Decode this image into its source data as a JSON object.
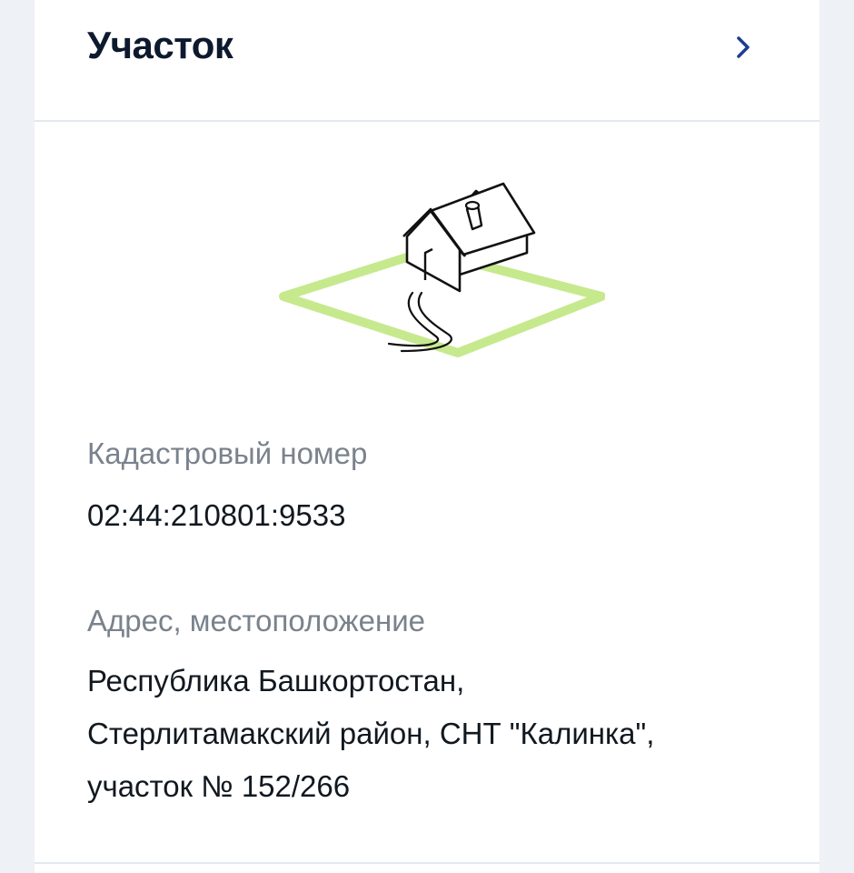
{
  "header": {
    "title": "Участок",
    "chevron_icon": "chevron-right-icon",
    "accent_color": "#1a3f8f"
  },
  "illustration": {
    "icon": "house-on-plot-icon",
    "plot_color": "#c6e98e"
  },
  "fields": [
    {
      "label": "Кадастровый номер",
      "value": "02:44:210801:9533"
    },
    {
      "label": "Адрес, местоположение",
      "value_lines": [
        "Республика Башкортостан,",
        "Стерлитамакский район, СНТ \"Калинка\",",
        "участок № 152/266"
      ]
    }
  ]
}
